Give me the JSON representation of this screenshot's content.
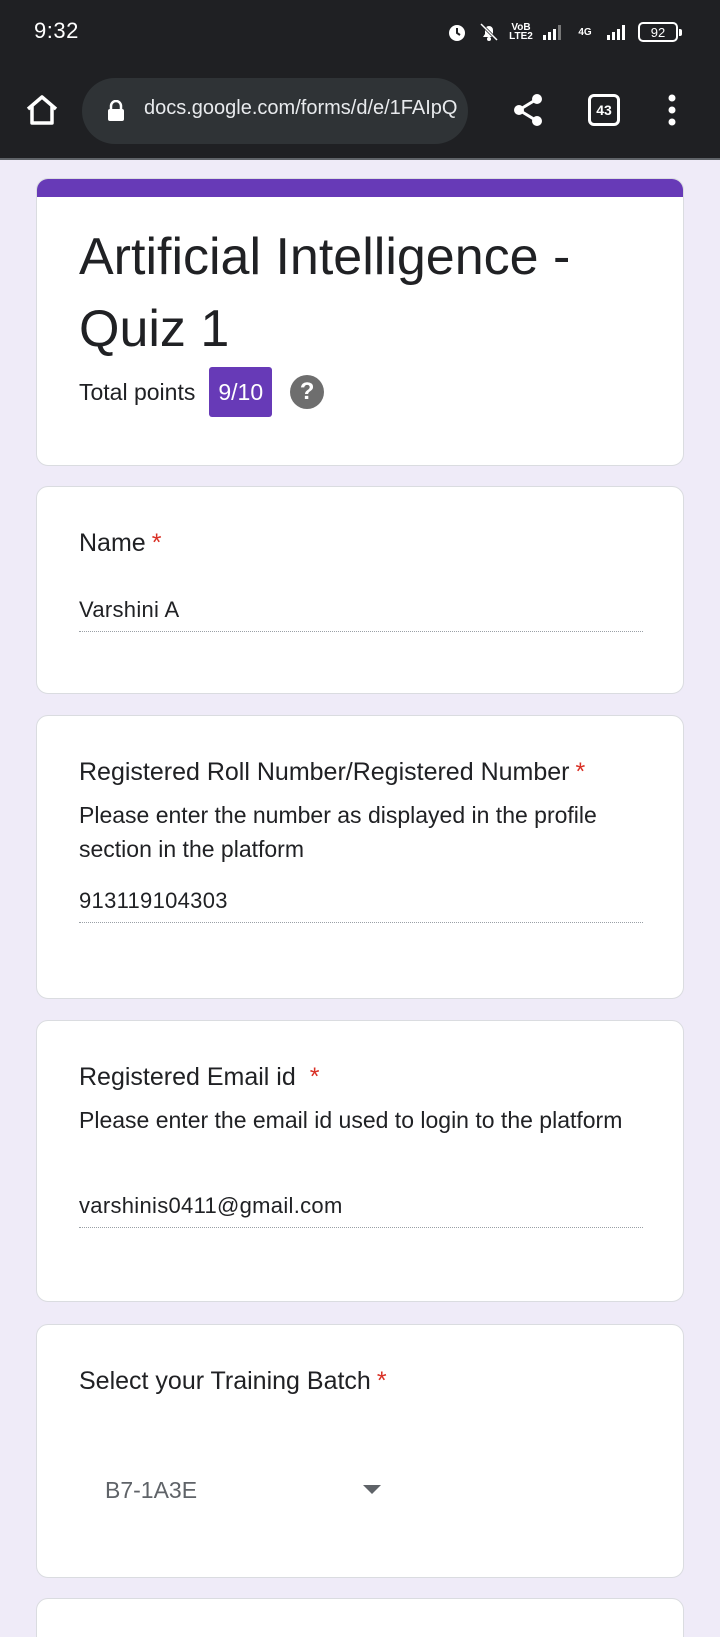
{
  "status_bar": {
    "time": "9:32",
    "network_label": "4G",
    "volte_label": "VoB LTE2",
    "battery": "92"
  },
  "browser": {
    "url": "docs.google.com/forms/d/e/1FAIpQ",
    "tab_count": "43",
    "accent_color": "#673ab7"
  },
  "form": {
    "title": "Artificial Intelligence - Quiz 1",
    "total_points_label": "Total points",
    "score": "9/10",
    "help_glyph": "?"
  },
  "questions": [
    {
      "label": "Name",
      "required_mark": "*",
      "answer": "Varshini A"
    },
    {
      "label": "Registered Roll Number/Registered Number",
      "required_mark": "*",
      "help": "Please enter the number as displayed in the profile section in the platform",
      "answer": "913119104303"
    },
    {
      "label": "Registered Email id",
      "required_mark": "*",
      "help": "Please enter the email id used to login to the platform",
      "answer": "varshinis0411@gmail.com"
    },
    {
      "label": "Select your Training Batch",
      "required_mark": "*",
      "selected": "B7-1A3E"
    }
  ]
}
